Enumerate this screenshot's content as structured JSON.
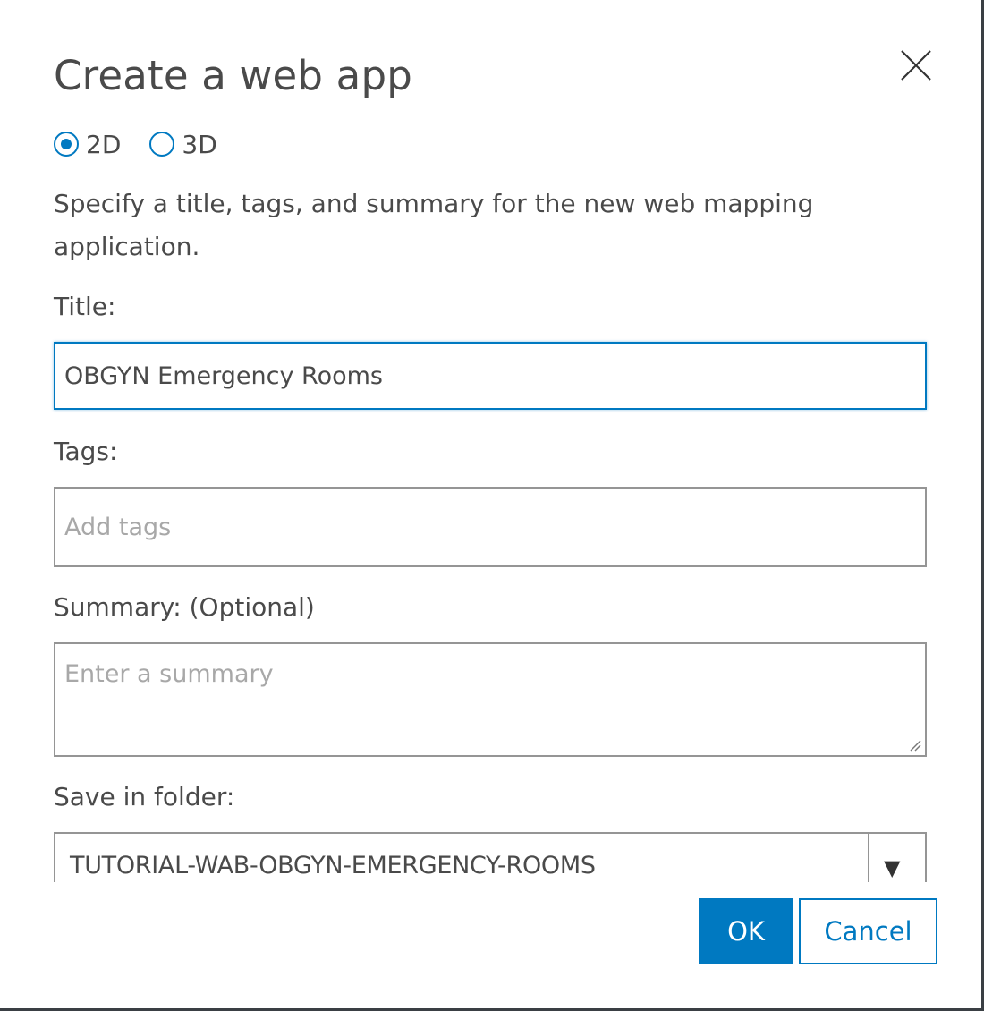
{
  "dialog": {
    "title": "Create a web app",
    "close_icon": "close-icon"
  },
  "dimension": {
    "options": [
      {
        "label": "2D",
        "checked": true
      },
      {
        "label": "3D",
        "checked": false
      }
    ]
  },
  "description": "Specify a title, tags, and summary for the new web mapping application.",
  "fields": {
    "title_label": "Title:",
    "title_value": "OBGYN Emergency Rooms",
    "tags_label": "Tags:",
    "tags_placeholder": "Add tags",
    "summary_label": "Summary: (Optional)",
    "summary_placeholder": "Enter a summary",
    "folder_label": "Save in folder:",
    "folder_value": "TUTORIAL-WAB-OBGYN-EMERGENCY-ROOMS",
    "folder_arrow": "▼"
  },
  "buttons": {
    "ok_label": "OK",
    "cancel_label": "Cancel"
  },
  "colors": {
    "accent": "#0079c1",
    "text": "#4a4a4a",
    "border": "#959595"
  }
}
